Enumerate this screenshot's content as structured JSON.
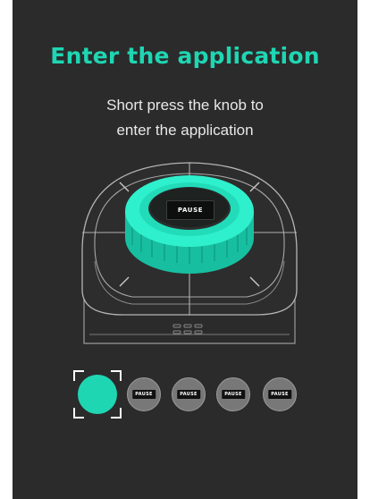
{
  "screen": {
    "title": "Enter the application",
    "instruction_line1": "Short press the knob to",
    "instruction_line2": "enter the application"
  },
  "device": {
    "knob_display_text": "PAUSE",
    "accent_color": "#1fd6b3"
  },
  "app_carousel": {
    "items": [
      {
        "label": "",
        "selected": true
      },
      {
        "label": "PAUSE",
        "selected": false
      },
      {
        "label": "PAUSE",
        "selected": false
      },
      {
        "label": "PAUSE",
        "selected": false
      },
      {
        "label": "PAUSE",
        "selected": false
      }
    ]
  }
}
